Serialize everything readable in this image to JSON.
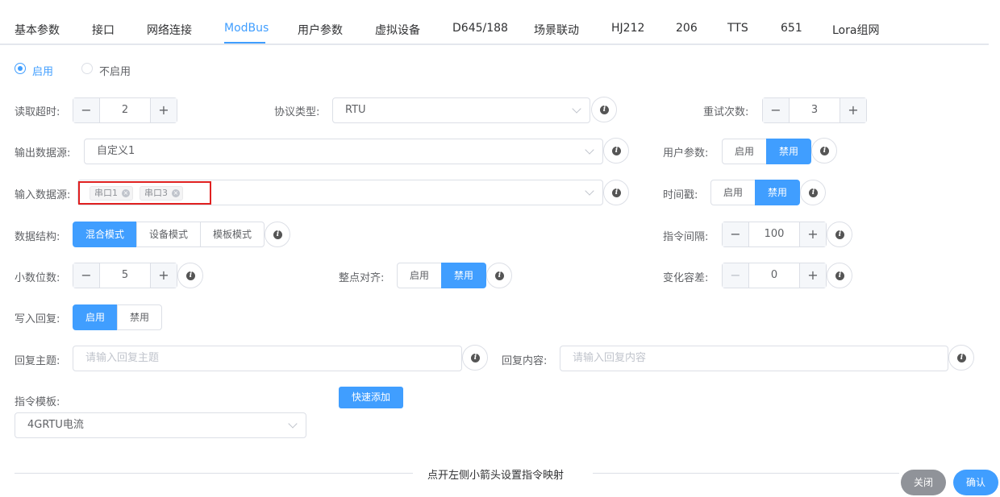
{
  "tabs": [
    "基本参数",
    "接口",
    "网络连接",
    "ModBus",
    "用户参数",
    "虚拟设备",
    "D645/188",
    "场景联动",
    "HJ212",
    "206",
    "TTS",
    "651",
    "Lora组网"
  ],
  "active_tab": "ModBus",
  "enable": {
    "on": "启用",
    "off": "不启用",
    "selected": "启用"
  },
  "read_timeout": {
    "label": "读取超时:",
    "value": "2"
  },
  "protocol": {
    "label": "协议类型:",
    "value": "RTU"
  },
  "retry": {
    "label": "重试次数:",
    "value": "3"
  },
  "output_source": {
    "label": "输出数据源:",
    "value": "自定义1"
  },
  "user_params": {
    "label": "用户参数:",
    "on": "启用",
    "off": "禁用",
    "selected": "禁用"
  },
  "input_source": {
    "label": "输入数据源:",
    "tags": [
      "串口1",
      "串口3"
    ]
  },
  "timestamp": {
    "label": "时间戳:",
    "on": "启用",
    "off": "禁用",
    "selected": "禁用"
  },
  "data_structure": {
    "label": "数据结构:",
    "options": [
      "混合模式",
      "设备模式",
      "模板模式"
    ],
    "selected": "混合模式"
  },
  "cmd_interval": {
    "label": "指令间隔:",
    "value": "100"
  },
  "decimals": {
    "label": "小数位数:",
    "value": "5"
  },
  "align": {
    "label": "整点对齐:",
    "on": "启用",
    "off": "禁用",
    "selected": "禁用"
  },
  "tolerance": {
    "label": "变化容差:",
    "value": "0"
  },
  "write_reply": {
    "label": "写入回复:",
    "on": "启用",
    "off": "禁用",
    "selected": "启用"
  },
  "reply_topic": {
    "label": "回复主题:",
    "placeholder": "请输入回复主题"
  },
  "reply_content": {
    "label": "回复内容:",
    "placeholder": "请输入回复内容"
  },
  "cmd_template": {
    "label": "指令模板:",
    "value": "4GRTU电流",
    "quick_add": "快速添加"
  },
  "hint": "点开左侧小箭头设置指令映射",
  "footer": {
    "close": "关闭",
    "confirm": "确认"
  },
  "colors": {
    "primary": "#409eff",
    "close_btn": "#909399",
    "highlight": "#e02020"
  }
}
